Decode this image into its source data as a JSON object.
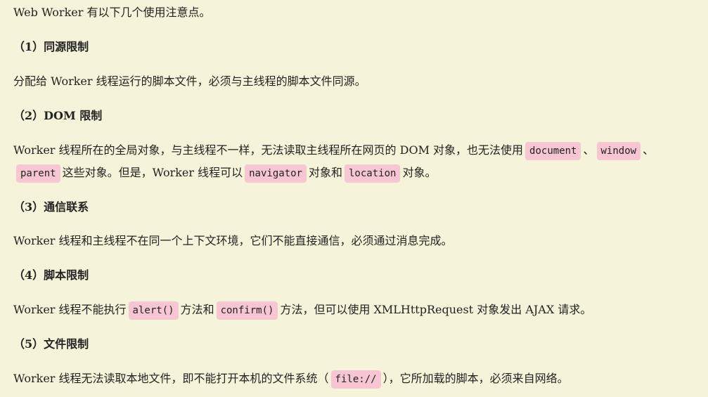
{
  "intro": "Web Worker 有以下几个使用注意点。",
  "sections": [
    {
      "heading": "（1）同源限制",
      "text": "分配给 Worker 线程运行的脚本文件，必须与主线程的脚本文件同源。"
    },
    {
      "heading": "（2）DOM 限制",
      "line1": {
        "t1": "Worker 线程所在的全局对象，与主线程不一样，无法读取主线程所在网页的 DOM 对象，也无法使用",
        "code1": "document",
        "t2": "、",
        "code2": "window",
        "t3": "、"
      },
      "line2": {
        "code1": "parent",
        "t1": "这些对象。但是，Worker 线程可以",
        "code2": "navigator",
        "t2": "对象和",
        "code3": "location",
        "t3": "对象。"
      }
    },
    {
      "heading": "（3）通信联系",
      "text": "Worker 线程和主线程不在同一个上下文环境，它们不能直接通信，必须通过消息完成。"
    },
    {
      "heading": "（4）脚本限制",
      "t1": "Worker 线程不能执行",
      "code1": "alert()",
      "t2": "方法和",
      "code2": "confirm()",
      "t3": "方法，但可以使用 XMLHttpRequest 对象发出 AJAX 请求。"
    },
    {
      "heading": "（5）文件限制",
      "t1": "Worker 线程无法读取本地文件，即不能打开本机的文件系统（",
      "code1": "file://",
      "t2": "），它所加载的脚本，必须来自网络。"
    }
  ]
}
